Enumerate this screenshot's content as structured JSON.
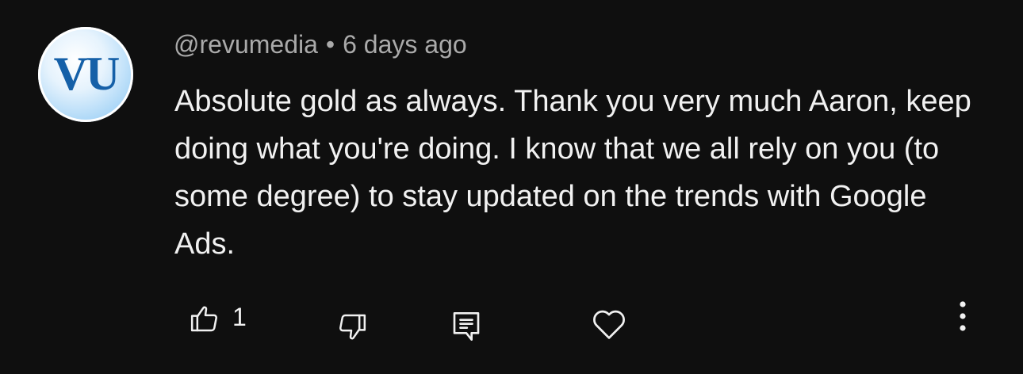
{
  "comment": {
    "avatar": {
      "initials": "VU",
      "colors": {
        "text": "#1560a8",
        "ring": "#ffffff",
        "fill": "#a9d6f7"
      }
    },
    "author": "@revumedia",
    "separator": "•",
    "timestamp": "6 days ago",
    "text": "Absolute gold as always. Thank you very much Aaron, keep doing what you're doing. I know that we all rely on you (to some degree) to stay updated on the trends with Google Ads.",
    "like_count": "1",
    "icons": {
      "like": "thumbs-up-icon",
      "dislike": "thumbs-down-icon",
      "reply": "reply-comment-icon",
      "heart": "heart-icon",
      "more": "more-vertical-icon"
    }
  },
  "theme": {
    "background": "#0f0f0f",
    "text_primary": "#f1f1f1",
    "text_secondary": "#aaaaaa"
  }
}
